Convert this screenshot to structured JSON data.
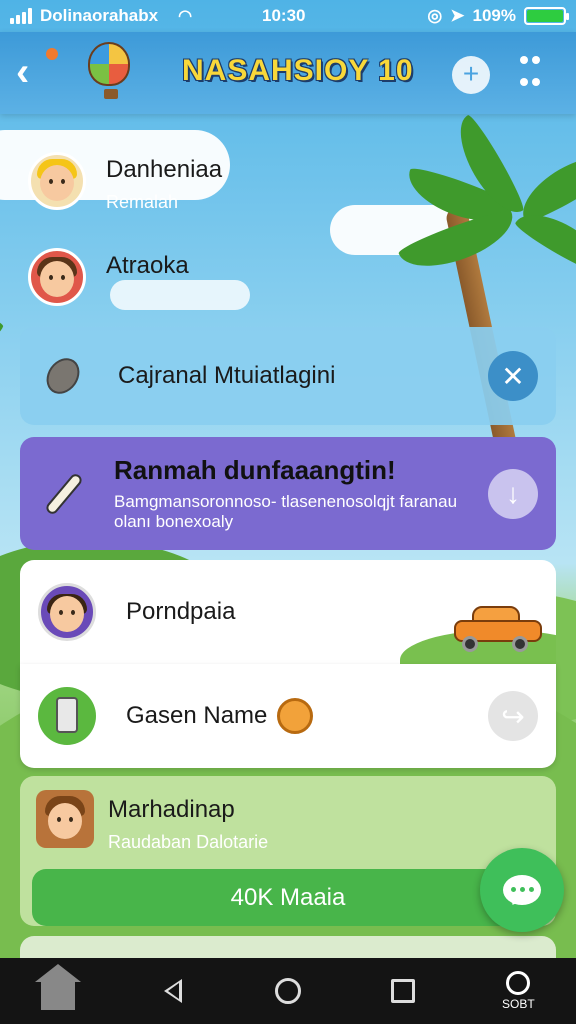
{
  "status_bar": {
    "carrier": "Dolinaorahabx",
    "time": "10:30",
    "battery_text": "109%"
  },
  "header": {
    "title": "NASAHSIOY 10"
  },
  "contacts": [
    {
      "name": "Danheniaa",
      "sub": "Remalah"
    },
    {
      "name": "Atraoka",
      "sub": ""
    }
  ],
  "search_card": {
    "title": "Cajranal Mtuiatlagini"
  },
  "promo_card": {
    "title": "Ranmah dunfaaangtin!",
    "description": "Bamgmansoronnoso- tlasenenosolqjt faranau olanı bonexoaly"
  },
  "list_cards": [
    {
      "title": "Porndpaia"
    },
    {
      "title": "Gasen Name"
    }
  ],
  "green_card": {
    "title": "Marhadinap",
    "sub": "Raudaban Dalotarie",
    "button_label": "40K Maaia"
  },
  "navbar": {
    "last_label": "SOBT"
  },
  "colors": {
    "header": "#3d9ad8",
    "promo": "#7b6ad0",
    "ok_button": "#48b54a",
    "fab": "#3fbf5a",
    "title_yellow": "#f8d83a"
  }
}
